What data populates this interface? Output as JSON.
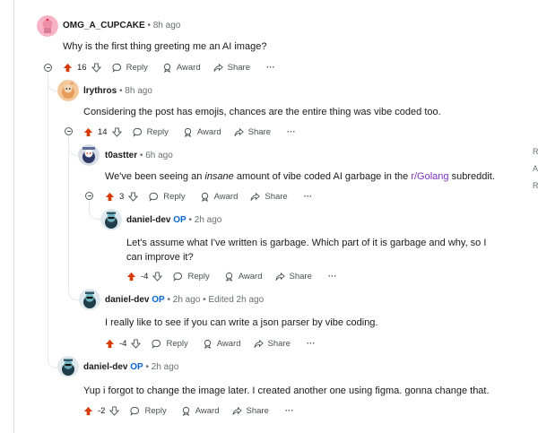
{
  "comments": [
    {
      "author": "OMG_A_CUPCAKE",
      "sep": " • ",
      "time": "8h ago",
      "body": "Why is the first thing greeting me an AI image?",
      "score": "16",
      "reply": "Reply",
      "award": "Award",
      "share": "Share",
      "more": "···"
    },
    {
      "author": "lrythros",
      "sep": " • ",
      "time": "8h ago",
      "body": "Considering the post has emojis, chances are the entire thing was vibe coded too.",
      "score": "14",
      "reply": "Reply",
      "award": "Award",
      "share": "Share",
      "more": "···"
    },
    {
      "author": "t0astter",
      "sep": " • ",
      "time": "6h ago",
      "body_pre": "We've been seeing an ",
      "body_em": "insane",
      "body_mid": " amount of vibe coded AI garbage in the ",
      "body_link": "r/Golang",
      "body_post": " subreddit.",
      "score": "3",
      "reply": "Reply",
      "award": "Award",
      "share": "Share",
      "more": "···"
    },
    {
      "author": "daniel-dev",
      "op": "OP",
      "sep": " • ",
      "time": "2h ago",
      "body": "Let's assume what I've written is garbage. Which part of it is garbage and why, so I can improve it?",
      "score": "-4",
      "reply": "Reply",
      "award": "Award",
      "share": "Share",
      "more": "···"
    },
    {
      "author": "daniel-dev",
      "op": "OP",
      "sep": " • ",
      "time": "2h ago",
      "edited": " • Edited 2h ago",
      "body": "I really like to see if you can write a json parser by vibe coding.",
      "score": "-4",
      "reply": "Reply",
      "award": "Award",
      "share": "Share",
      "more": "···"
    },
    {
      "author": "daniel-dev",
      "op": "OP",
      "sep": " • ",
      "time": "2h ago",
      "body": "Yup i forgot to change the image later. I created another one using figma. gonna change that.",
      "score": "-2",
      "reply": "Reply",
      "award": "Award",
      "share": "Share",
      "more": "···"
    }
  ],
  "sidebar_fragments": [
    "R",
    "A",
    "R"
  ],
  "colors": {
    "upvote": "#d93a00",
    "text": "#1a1a1b",
    "meta": "#6a6e72",
    "op": "#0a66d4",
    "link": "#7b2fbf",
    "thread_line": "#e5e7ea"
  },
  "icons": {
    "upvote": "arrow-up-icon",
    "downvote": "arrow-down-icon",
    "reply": "speech-bubble-icon",
    "award": "award-icon",
    "share": "share-icon",
    "more": "more-icon",
    "collapse": "collapse-minus-icon"
  }
}
